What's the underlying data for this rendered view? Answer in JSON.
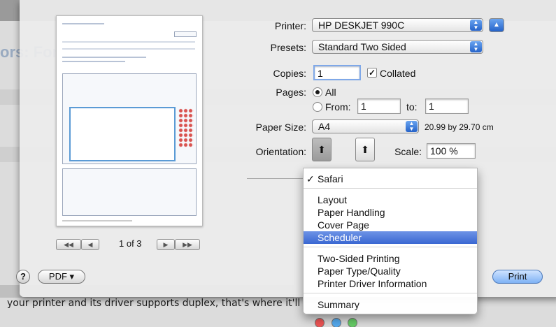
{
  "background": {
    "forum_title": "ors: For",
    "body_text": "your printer and its driver supports duplex, that's where it'll"
  },
  "preview": {
    "page_indicator": "1 of 3"
  },
  "printer": {
    "label": "Printer:",
    "value": "HP DESKJET 990C"
  },
  "presets": {
    "label": "Presets:",
    "value": "Standard Two Sided"
  },
  "copies": {
    "label": "Copies:",
    "value": "1",
    "collated_label": "Collated"
  },
  "pages": {
    "label": "Pages:",
    "all_label": "All",
    "from_label": "From:",
    "from_value": "1",
    "to_label": "to:",
    "to_value": "1"
  },
  "paper_size": {
    "label": "Paper Size:",
    "value": "A4",
    "dimensions": "20.99 by 29.70 cm"
  },
  "orientation": {
    "label": "Orientation:"
  },
  "scale": {
    "label": "Scale:",
    "value": "100 %"
  },
  "menu": {
    "items": [
      {
        "label": "Safari",
        "checked": true
      },
      {
        "label": "Layout"
      },
      {
        "label": "Paper Handling"
      },
      {
        "label": "Cover Page"
      },
      {
        "label": "Scheduler",
        "selected": true
      },
      {
        "label": "Two-Sided Printing"
      },
      {
        "label": "Paper Type/Quality"
      },
      {
        "label": "Printer Driver Information"
      },
      {
        "label": "Summary"
      }
    ]
  },
  "buttons": {
    "help": "?",
    "pdf": "PDF ▾",
    "print": "Print"
  },
  "colors": {
    "accent": "#3a67d2",
    "default_button": "#7fb2f5"
  }
}
